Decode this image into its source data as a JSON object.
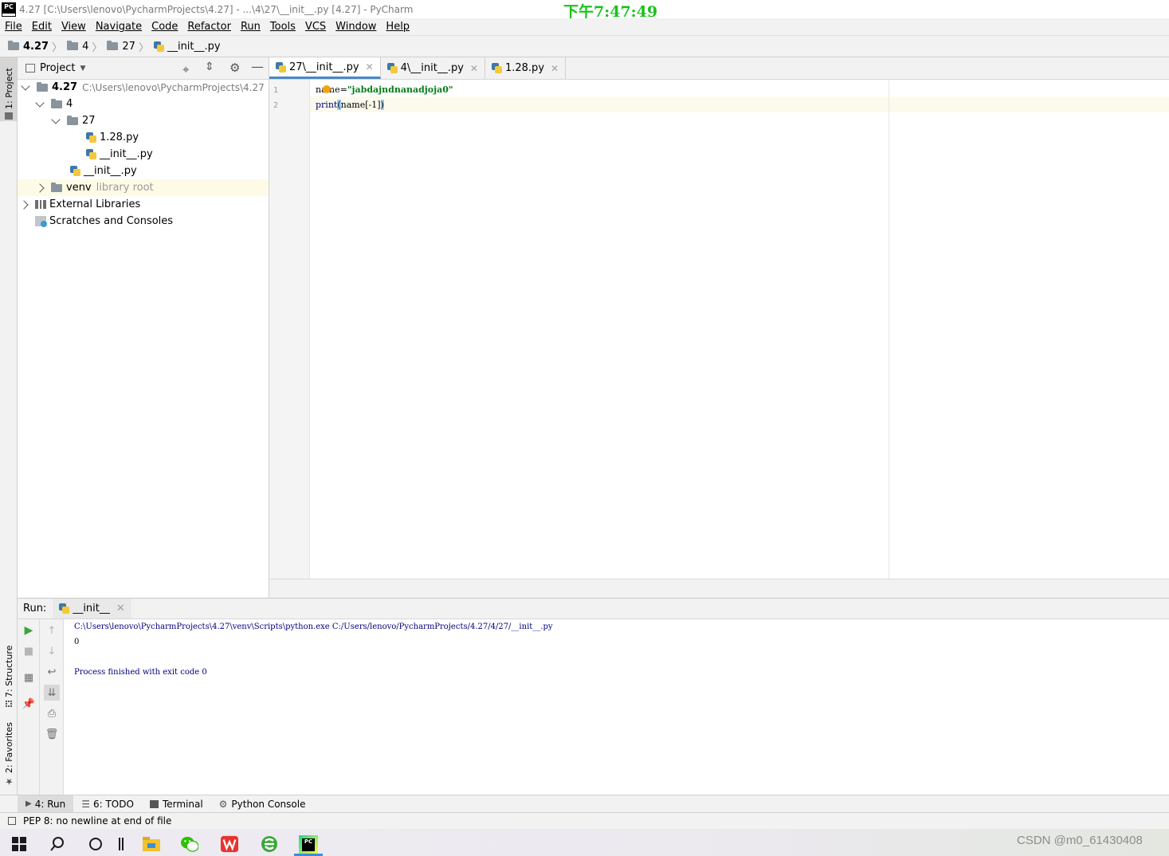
{
  "window": {
    "title": "4.27 [C:\\Users\\lenovo\\PycharmProjects\\4.27] - ...\\4\\27\\__init__.py [4.27] - PyCharm",
    "logo": "PC",
    "clock": "下午7:47:49"
  },
  "menu": {
    "items": [
      {
        "label": "File"
      },
      {
        "label": "Edit"
      },
      {
        "label": "View"
      },
      {
        "label": "Navigate"
      },
      {
        "label": "Code"
      },
      {
        "label": "Refactor"
      },
      {
        "label": "Run"
      },
      {
        "label": "Tools"
      },
      {
        "label": "VCS"
      },
      {
        "label": "Window"
      },
      {
        "label": "Help"
      }
    ]
  },
  "breadcrumb": {
    "items": [
      "4.27",
      "4",
      "27",
      "__init__.py"
    ]
  },
  "left_strip": {
    "project_tab": "1: Project",
    "structure_tab": "7: Structure",
    "favorites_tab": "2: Favorites"
  },
  "project": {
    "header_label": "Project",
    "tree": {
      "root_name": "4.27",
      "root_path": "C:\\Users\\lenovo\\PycharmProjects\\4.27",
      "folder_4": "4",
      "folder_27": "27",
      "file_128": "1.28.py",
      "file_init_27": "__init__.py",
      "file_init_4": "__init__.py",
      "venv": "venv",
      "venv_hint": "library root",
      "external_libraries": "External Libraries",
      "scratches": "Scratches and Consoles"
    }
  },
  "editor": {
    "tabs": [
      {
        "label": "27\\__init__.py",
        "active": true
      },
      {
        "label": "4\\__init__.py",
        "active": false
      },
      {
        "label": "1.28.py",
        "active": false
      }
    ],
    "lines": [
      {
        "no": "1",
        "var": "name",
        "op": "=",
        "str": "\"jabdajndnanadjoja0\""
      },
      {
        "no": "2",
        "func": "print",
        "open": "(",
        "arg": "name[-1]",
        "close": ")"
      }
    ]
  },
  "run": {
    "label": "Run:",
    "tab_label": "__init__",
    "output": {
      "command": "C:\\Users\\lenovo\\PycharmProjects\\4.27\\venv\\Scripts\\python.exe C:/Users/lenovo/PycharmProjects/4.27/4/27/__init__.py",
      "result": "0",
      "exit": "Process finished with exit code 0"
    }
  },
  "bottom_tabs": {
    "run": "4: Run",
    "todo": "6: TODO",
    "terminal": "Terminal",
    "python_console": "Python Console"
  },
  "status": {
    "message": "PEP 8: no newline at end of file"
  },
  "taskbar": {
    "watermark": "CSDN @m0_61430408",
    "pycharm_label": "PC"
  },
  "colors": {
    "clock": "#19c219",
    "string_literal": "#067d17",
    "number_literal": "#1750eb",
    "console_text": "#000080",
    "tab_underline": "#4a88c7"
  }
}
